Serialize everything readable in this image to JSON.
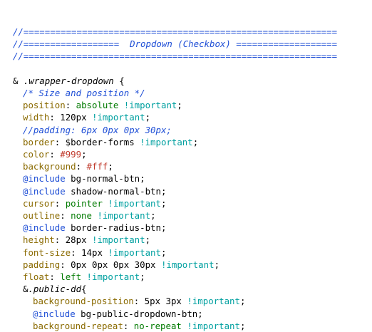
{
  "colors": {
    "background": "#ffffff",
    "plain": "#000000",
    "comment": "#1f4fd6",
    "property": "#8a6a00",
    "keyword": "#00a0a0",
    "value": "#007a00",
    "color_value": "#c0392b",
    "directive": "#1f4fd6",
    "selector": "#000000"
  },
  "editor": {
    "lines": [
      {
        "indent": 0,
        "tokens": [
          {
            "t": "//===========================================================",
            "k": "comment"
          }
        ]
      },
      {
        "indent": 0,
        "tokens": [
          {
            "t": "//==================  Dropdown (Checkbox) ===================",
            "k": "comment"
          }
        ]
      },
      {
        "indent": 0,
        "tokens": [
          {
            "t": "//===========================================================",
            "k": "comment"
          }
        ]
      },
      {
        "indent": 0,
        "tokens": []
      },
      {
        "indent": 0,
        "tokens": [
          {
            "t": "& ",
            "k": "plain"
          },
          {
            "t": ".wrapper-dropdown",
            "k": "selector"
          },
          {
            "t": " {",
            "k": "plain"
          }
        ]
      },
      {
        "indent": 1,
        "tokens": [
          {
            "t": "/* Size and position */",
            "k": "comment"
          }
        ]
      },
      {
        "indent": 1,
        "tokens": [
          {
            "t": "position",
            "k": "property"
          },
          {
            "t": ": ",
            "k": "plain"
          },
          {
            "t": "absolute",
            "k": "value"
          },
          {
            "t": " ",
            "k": "plain"
          },
          {
            "t": "!important",
            "k": "keyword"
          },
          {
            "t": ";",
            "k": "plain"
          }
        ]
      },
      {
        "indent": 1,
        "tokens": [
          {
            "t": "width",
            "k": "property"
          },
          {
            "t": ": ",
            "k": "plain"
          },
          {
            "t": "120px",
            "k": "plain"
          },
          {
            "t": " ",
            "k": "plain"
          },
          {
            "t": "!important",
            "k": "keyword"
          },
          {
            "t": ";",
            "k": "plain"
          }
        ]
      },
      {
        "indent": 1,
        "tokens": [
          {
            "t": "//padding: 6px 0px 0px 30px;",
            "k": "comment"
          }
        ]
      },
      {
        "indent": 1,
        "tokens": [
          {
            "t": "border",
            "k": "property"
          },
          {
            "t": ": $border-forms ",
            "k": "plain"
          },
          {
            "t": "!important",
            "k": "keyword"
          },
          {
            "t": ";",
            "k": "plain"
          }
        ]
      },
      {
        "indent": 1,
        "tokens": [
          {
            "t": "color",
            "k": "property"
          },
          {
            "t": ": ",
            "k": "plain"
          },
          {
            "t": "#999",
            "k": "color_value"
          },
          {
            "t": ";",
            "k": "plain"
          }
        ]
      },
      {
        "indent": 1,
        "tokens": [
          {
            "t": "background",
            "k": "property"
          },
          {
            "t": ": ",
            "k": "plain"
          },
          {
            "t": "#fff",
            "k": "color_value"
          },
          {
            "t": ";",
            "k": "plain"
          }
        ]
      },
      {
        "indent": 1,
        "tokens": [
          {
            "t": "@include",
            "k": "directive"
          },
          {
            "t": " bg-normal-btn;",
            "k": "plain"
          }
        ]
      },
      {
        "indent": 1,
        "tokens": [
          {
            "t": "@include",
            "k": "directive"
          },
          {
            "t": " shadow-normal-btn;",
            "k": "plain"
          }
        ]
      },
      {
        "indent": 1,
        "tokens": [
          {
            "t": "cursor",
            "k": "property"
          },
          {
            "t": ": ",
            "k": "plain"
          },
          {
            "t": "pointer",
            "k": "value"
          },
          {
            "t": " ",
            "k": "plain"
          },
          {
            "t": "!important",
            "k": "keyword"
          },
          {
            "t": ";",
            "k": "plain"
          }
        ]
      },
      {
        "indent": 1,
        "tokens": [
          {
            "t": "outline",
            "k": "property"
          },
          {
            "t": ": ",
            "k": "plain"
          },
          {
            "t": "none",
            "k": "value"
          },
          {
            "t": " ",
            "k": "plain"
          },
          {
            "t": "!important",
            "k": "keyword"
          },
          {
            "t": ";",
            "k": "plain"
          }
        ]
      },
      {
        "indent": 1,
        "tokens": [
          {
            "t": "@include",
            "k": "directive"
          },
          {
            "t": " border-radius-btn;",
            "k": "plain"
          }
        ]
      },
      {
        "indent": 1,
        "tokens": [
          {
            "t": "height",
            "k": "property"
          },
          {
            "t": ": ",
            "k": "plain"
          },
          {
            "t": "28px",
            "k": "plain"
          },
          {
            "t": " ",
            "k": "plain"
          },
          {
            "t": "!important",
            "k": "keyword"
          },
          {
            "t": ";",
            "k": "plain"
          }
        ]
      },
      {
        "indent": 1,
        "tokens": [
          {
            "t": "font-size",
            "k": "property"
          },
          {
            "t": ": ",
            "k": "plain"
          },
          {
            "t": "14px",
            "k": "plain"
          },
          {
            "t": " ",
            "k": "plain"
          },
          {
            "t": "!important",
            "k": "keyword"
          },
          {
            "t": ";",
            "k": "plain"
          }
        ]
      },
      {
        "indent": 1,
        "tokens": [
          {
            "t": "padding",
            "k": "property"
          },
          {
            "t": ": ",
            "k": "plain"
          },
          {
            "t": "0px 0px 0px 30px",
            "k": "plain"
          },
          {
            "t": " ",
            "k": "plain"
          },
          {
            "t": "!important",
            "k": "keyword"
          },
          {
            "t": ";",
            "k": "plain"
          }
        ]
      },
      {
        "indent": 1,
        "tokens": [
          {
            "t": "float",
            "k": "property"
          },
          {
            "t": ": ",
            "k": "plain"
          },
          {
            "t": "left",
            "k": "value"
          },
          {
            "t": " ",
            "k": "plain"
          },
          {
            "t": "!important",
            "k": "keyword"
          },
          {
            "t": ";",
            "k": "plain"
          }
        ]
      },
      {
        "indent": 1,
        "tokens": [
          {
            "t": "&",
            "k": "plain"
          },
          {
            "t": ".public-dd",
            "k": "selector"
          },
          {
            "t": "{",
            "k": "plain"
          }
        ]
      },
      {
        "indent": 2,
        "tokens": [
          {
            "t": "background-position",
            "k": "property"
          },
          {
            "t": ": ",
            "k": "plain"
          },
          {
            "t": "5px 3px",
            "k": "plain"
          },
          {
            "t": " ",
            "k": "plain"
          },
          {
            "t": "!important",
            "k": "keyword"
          },
          {
            "t": ";",
            "k": "plain"
          }
        ]
      },
      {
        "indent": 2,
        "tokens": [
          {
            "t": "@include",
            "k": "directive"
          },
          {
            "t": " bg-public-dropdown-btn;",
            "k": "plain"
          }
        ]
      },
      {
        "indent": 2,
        "tokens": [
          {
            "t": "background-repeat",
            "k": "property"
          },
          {
            "t": ": ",
            "k": "plain"
          },
          {
            "t": "no-repeat",
            "k": "value"
          },
          {
            "t": " ",
            "k": "plain"
          },
          {
            "t": "!important",
            "k": "keyword"
          },
          {
            "t": ";",
            "k": "plain"
          }
        ]
      },
      {
        "indent": 1,
        "tokens": [
          {
            "t": "}",
            "k": "plain"
          }
        ]
      }
    ]
  }
}
